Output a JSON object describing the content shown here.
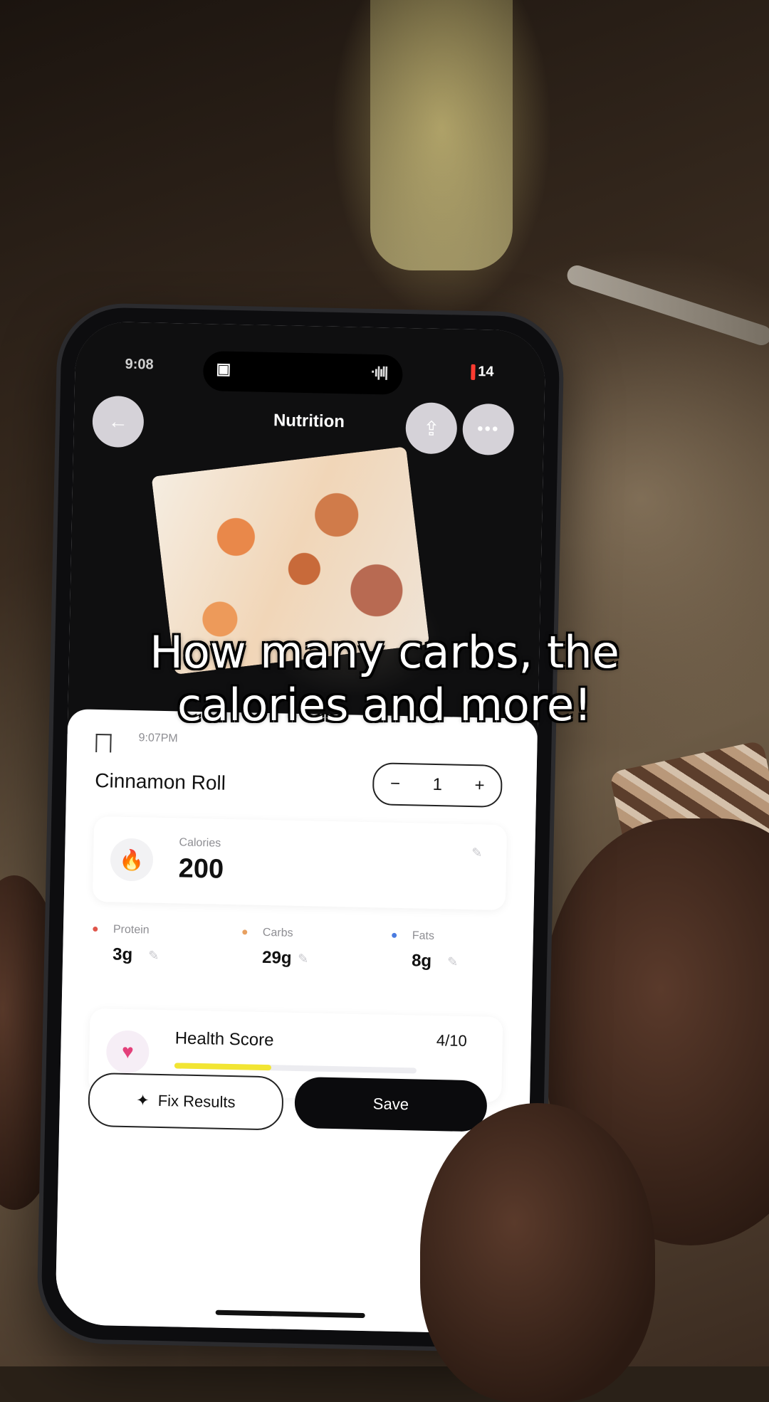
{
  "status_bar": {
    "time": "9:08",
    "battery": "14"
  },
  "nav": {
    "title": "Nutrition"
  },
  "entry": {
    "time": "9:07PM",
    "name": "Cinnamon Roll",
    "quantity": "1"
  },
  "calories": {
    "label": "Calories",
    "value": "200"
  },
  "macros": [
    {
      "label": "Protein",
      "value": "3g",
      "color": "#e0554a"
    },
    {
      "label": "Carbs",
      "value": "29g",
      "color": "#e8a060"
    },
    {
      "label": "Fats",
      "value": "8g",
      "color": "#4a7be0"
    }
  ],
  "health": {
    "label": "Health Score",
    "value": "4/10",
    "fraction": 0.4,
    "color": "#f2e533"
  },
  "buttons": {
    "fix": "Fix Results",
    "save": "Save"
  },
  "caption": {
    "line1": "How many carbs, the",
    "line2": "calories and more!"
  },
  "icons": {
    "back": "back-arrow-icon",
    "share": "share-icon",
    "more": "more-dots-icon",
    "flame": "flame-icon",
    "heart": "broken-heart-icon",
    "sparkle": "sparkle-icon",
    "bookmark": "bookmark-icon"
  }
}
